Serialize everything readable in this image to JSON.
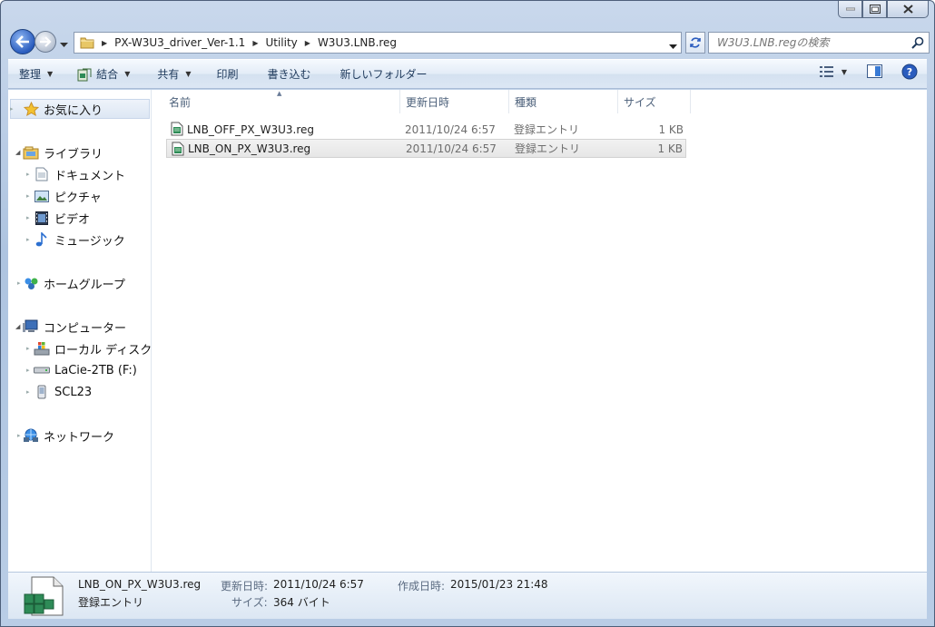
{
  "address": {
    "crumbs": [
      "PX-W3U3_driver_Ver-1.1",
      "Utility",
      "W3U3.LNB.reg"
    ]
  },
  "search": {
    "placeholder": "W3U3.LNB.regの検索"
  },
  "toolbar": {
    "organize": "整理",
    "combine": "結合",
    "share": "共有",
    "print": "印刷",
    "burn": "書き込む",
    "new_folder": "新しいフォルダー"
  },
  "nav": {
    "favorites": "お気に入り",
    "libraries": "ライブラリ",
    "documents": "ドキュメント",
    "pictures": "ピクチャ",
    "videos": "ビデオ",
    "music": "ミュージック",
    "homegroup": "ホームグループ",
    "computer": "コンピューター",
    "local_disk": "ローカル ディスク (",
    "lacie": "LaCie-2TB (F:)",
    "scl23": "SCL23",
    "network": "ネットワーク"
  },
  "columns": {
    "name": "名前",
    "date": "更新日時",
    "type": "種類",
    "size": "サイズ"
  },
  "files": [
    {
      "name": "LNB_OFF_PX_W3U3.reg",
      "date": "2011/10/24 6:57",
      "type": "登録エントリ",
      "size": "1 KB"
    },
    {
      "name": "LNB_ON_PX_W3U3.reg",
      "date": "2011/10/24 6:57",
      "type": "登録エントリ",
      "size": "1 KB"
    }
  ],
  "details": {
    "filename": "LNB_ON_PX_W3U3.reg",
    "filetype": "登録エントリ",
    "modified_label": "更新日時:",
    "modified_value": "2011/10/24 6:57",
    "created_label": "作成日時:",
    "created_value": "2015/01/23 21:48",
    "size_label": "サイズ:",
    "size_value": "364 バイト"
  },
  "colors": {
    "selection": "#e6e6e6",
    "toolbar_text": "#1e395b",
    "window_frame": "#aec4e0"
  }
}
